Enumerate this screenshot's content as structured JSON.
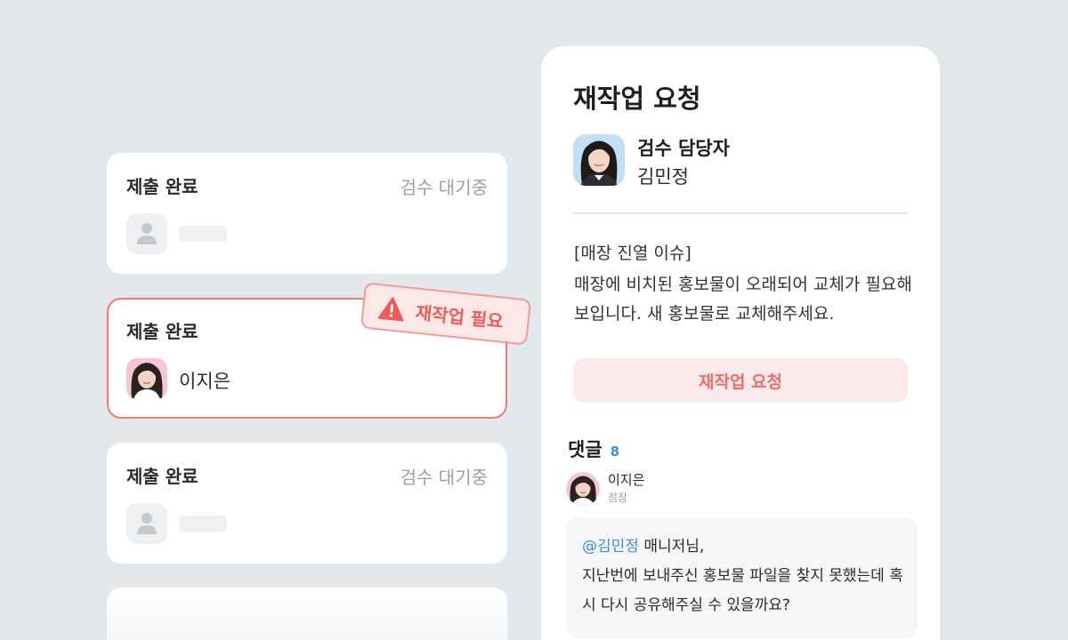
{
  "submissions": [
    {
      "title": "제출 완료",
      "status": "검수 대기중"
    },
    {
      "title": "제출 완료",
      "person": "이지은"
    },
    {
      "title": "제출 완료",
      "status": "검수 대기중"
    }
  ],
  "rework_tag": {
    "label": "재작업 필요",
    "icon": "warning-icon",
    "color": "#ef5b5b"
  },
  "panel": {
    "title": "재작업 요청",
    "reviewer": {
      "role": "검수 담당자",
      "name": "김민정"
    },
    "issue_tag": "[매장 진열 이슈]",
    "issue_body": "매장에 비치된 홍보물이 오래되어 교체가 필요해보입니다. 새 홍보물로 교체해주세요.",
    "button_label": "재작업 요청",
    "comments": {
      "label": "댓글",
      "count": "8",
      "author": "이지은",
      "author_role": "점장",
      "mention": "@김민정",
      "text": " 매니저님,\n지난번에 보내주신 홍보물 파일을 찾지 못했는데 혹시 다시 공유해주실 수 있을까요?"
    }
  },
  "colors": {
    "accent_red": "#ef5b5b",
    "mention_blue": "#3a8ee6",
    "background": "#e3e8ec"
  }
}
